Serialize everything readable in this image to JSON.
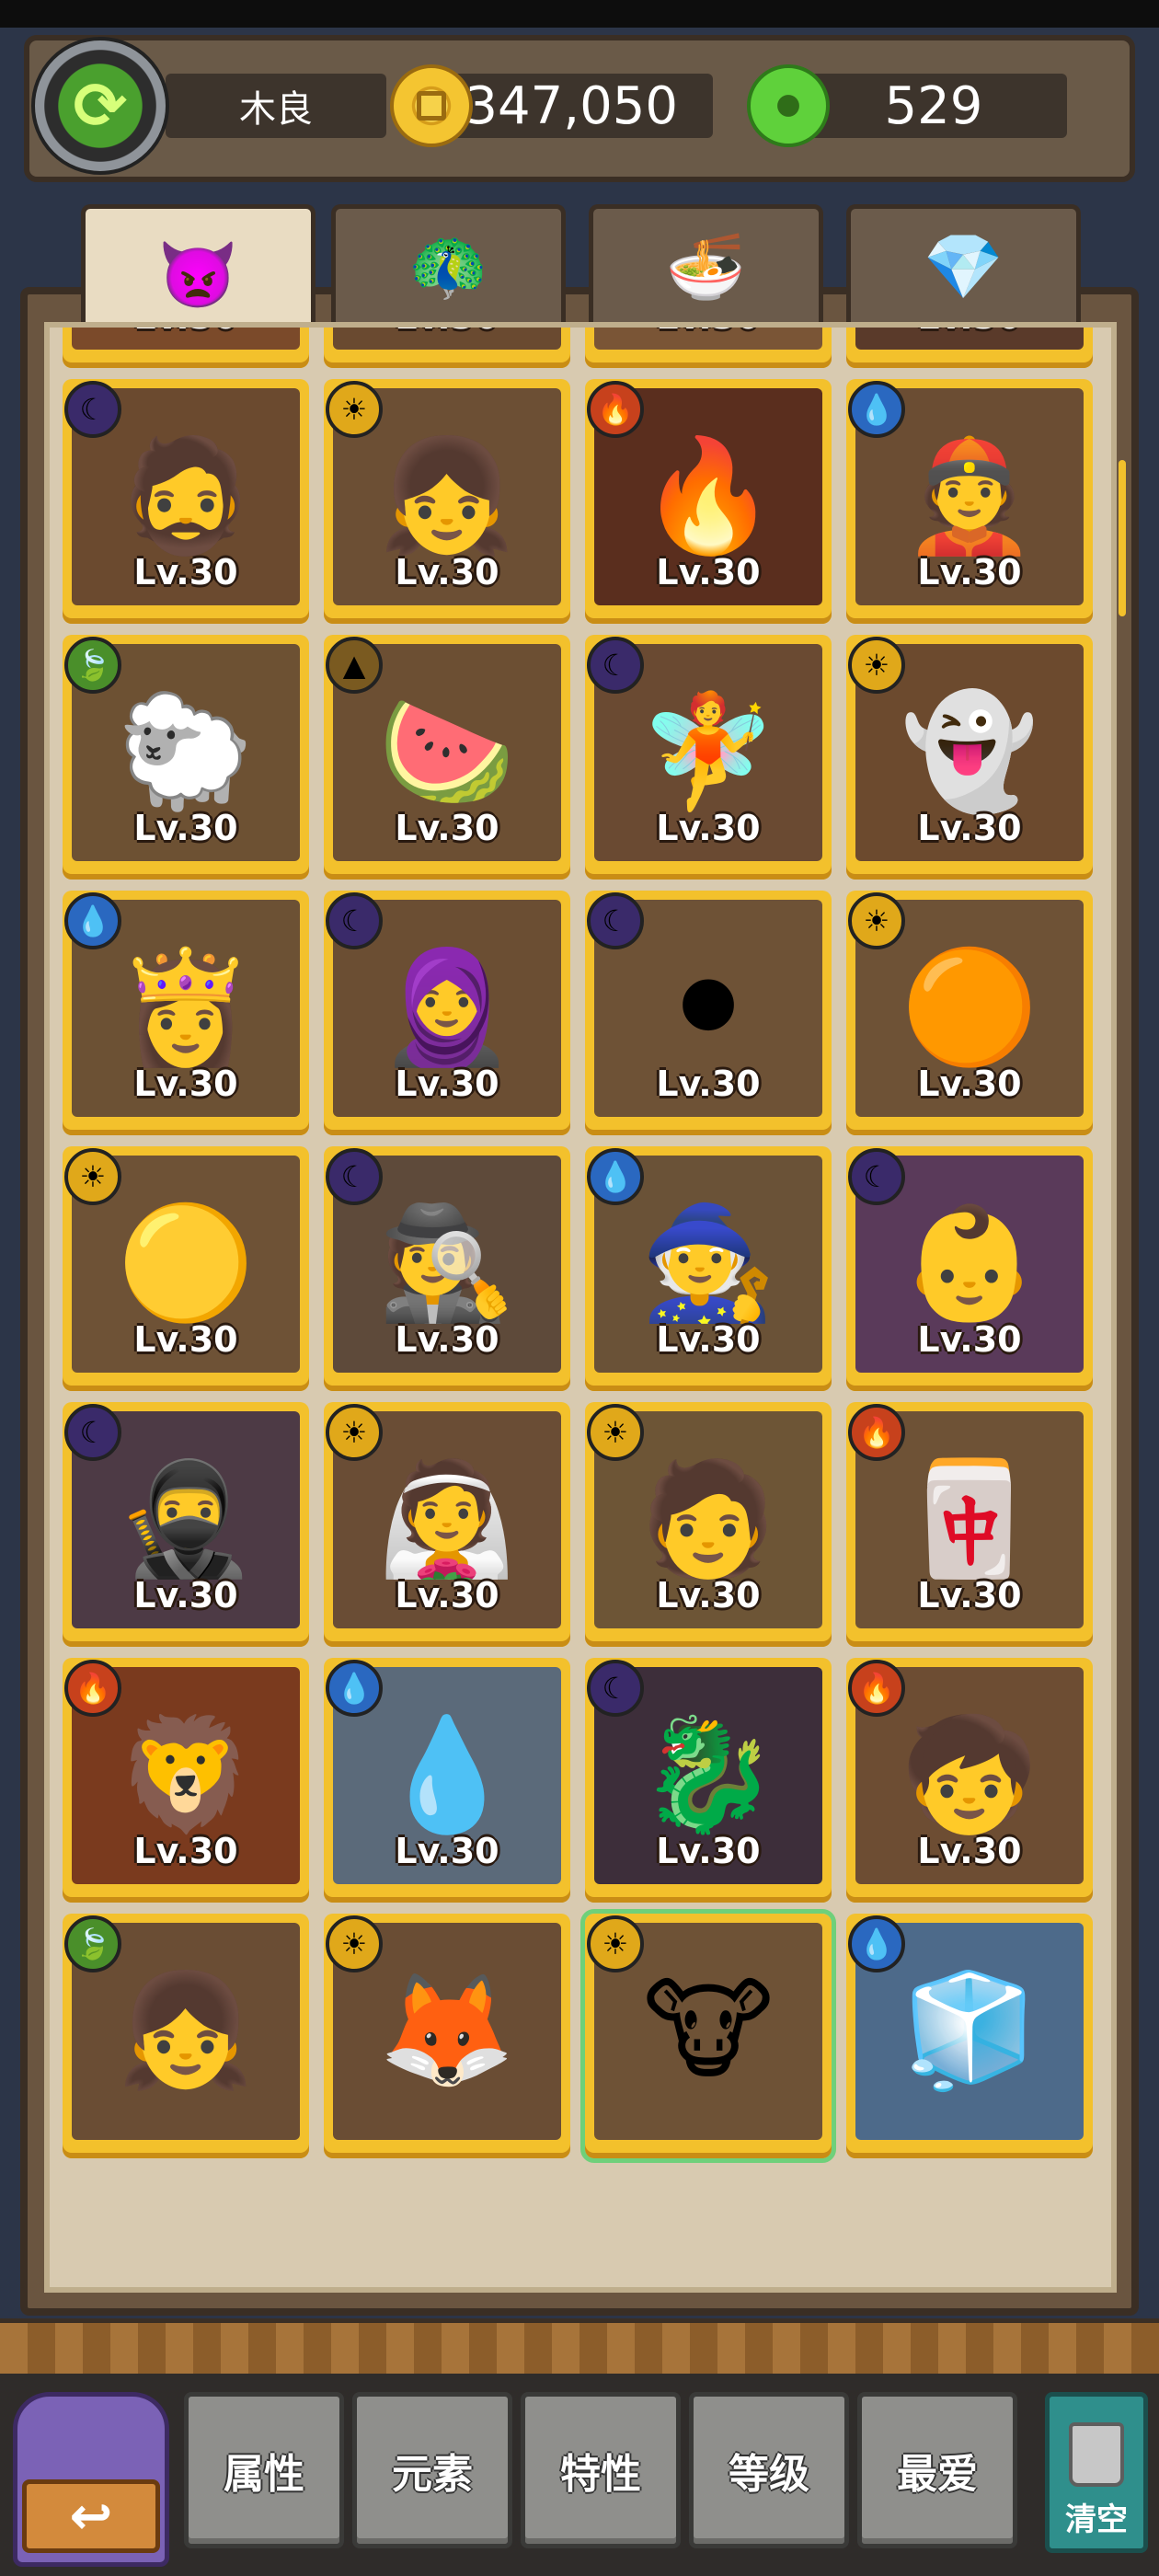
{
  "header": {
    "player_name": "木良",
    "coins": "347,050",
    "gems": "529"
  },
  "tabs": [
    {
      "label": "👿",
      "name": "monsters",
      "active": true
    },
    {
      "label": "🦚",
      "name": "relics",
      "active": false
    },
    {
      "label": "🍜",
      "name": "food",
      "active": false
    },
    {
      "label": "💎",
      "name": "crystal",
      "active": false
    }
  ],
  "cards": [
    {
      "portrait": "🧑‍🌾",
      "level": "Lv.30",
      "element": "fire",
      "bg": "#7b4a2a"
    },
    {
      "portrait": "🧝",
      "level": "Lv.30",
      "element": "water",
      "bg": "#6a4a30"
    },
    {
      "portrait": "🐯",
      "level": "Lv.30",
      "element": "leaf",
      "bg": "#7a5536"
    },
    {
      "portrait": "👩",
      "level": "Lv.30",
      "element": "earth",
      "bg": "#5a3a2a"
    },
    {
      "portrait": "🧔",
      "level": "Lv.30",
      "element": "moon",
      "bg": "#6b4a2f"
    },
    {
      "portrait": "👧",
      "level": "Lv.30",
      "element": "sun",
      "bg": "#6c4f34"
    },
    {
      "portrait": "🔥",
      "level": "Lv.30",
      "element": "fire",
      "bg": "#5a2e1e"
    },
    {
      "portrait": "👲",
      "level": "Lv.30",
      "element": "water",
      "bg": "#6b4d33"
    },
    {
      "portrait": "🐑",
      "level": "Lv.30",
      "element": "leaf",
      "bg": "#6d5133"
    },
    {
      "portrait": "🍉",
      "level": "Lv.30",
      "element": "earth",
      "bg": "#6c4f33"
    },
    {
      "portrait": "🧚",
      "level": "Lv.30",
      "element": "moon",
      "bg": "#6a4a32"
    },
    {
      "portrait": "👻",
      "level": "Lv.30",
      "element": "sun",
      "bg": "#6c4a2e"
    },
    {
      "portrait": "👸",
      "level": "Lv.30",
      "element": "water",
      "bg": "#6c5134"
    },
    {
      "portrait": "🧕",
      "level": "Lv.30",
      "element": "moon",
      "bg": "#6b4e33"
    },
    {
      "portrait": "⚫",
      "level": "Lv.30",
      "element": "moon",
      "bg": "#6e5236"
    },
    {
      "portrait": "🟠",
      "level": "Lv.30",
      "element": "sun",
      "bg": "#6e5236"
    },
    {
      "portrait": "🟡",
      "level": "Lv.30",
      "element": "sun",
      "bg": "#6e5236"
    },
    {
      "portrait": "🕵",
      "level": "Lv.30",
      "element": "moon",
      "bg": "#5e4a3a"
    },
    {
      "portrait": "🧙",
      "level": "Lv.30",
      "element": "water",
      "bg": "#6a5237"
    },
    {
      "portrait": "👶",
      "level": "Lv.30",
      "element": "moon",
      "bg": "#5a3a5a"
    },
    {
      "portrait": "🥷",
      "level": "Lv.30",
      "element": "moon",
      "bg": "#4d3a45"
    },
    {
      "portrait": "👰",
      "level": "Lv.30",
      "element": "sun",
      "bg": "#6a4d35"
    },
    {
      "portrait": "🧑",
      "level": "Lv.30",
      "element": "sun",
      "bg": "#6d5536"
    },
    {
      "portrait": "🀄",
      "level": "Lv.30",
      "element": "fire",
      "bg": "#6e5236"
    },
    {
      "portrait": "🦁",
      "level": "Lv.30",
      "element": "fire",
      "bg": "#7a3a1e"
    },
    {
      "portrait": "💧",
      "level": "Lv.30",
      "element": "water",
      "bg": "#5b6a7a"
    },
    {
      "portrait": "🐉",
      "level": "Lv.30",
      "element": "moon",
      "bg": "#3d2e3a"
    },
    {
      "portrait": "🧒",
      "level": "Lv.30",
      "element": "fire",
      "bg": "#6d4d33"
    },
    {
      "portrait": "👧",
      "level": "",
      "element": "leaf",
      "bg": "#6a4d34"
    },
    {
      "portrait": "🦊",
      "level": "",
      "element": "sun",
      "bg": "#6a4d34"
    },
    {
      "portrait": "🐮",
      "level": "",
      "element": "sun",
      "bg": "#6e5236",
      "selected": true
    },
    {
      "portrait": "🧊",
      "level": "",
      "element": "water",
      "bg": "#4d6a8a"
    }
  ],
  "elements": {
    "fire": {
      "glyph": "🔥",
      "color": "#c7411c"
    },
    "water": {
      "glyph": "💧",
      "color": "#2a68c0"
    },
    "leaf": {
      "glyph": "🍃",
      "color": "#4a8f2a"
    },
    "earth": {
      "glyph": "▲",
      "color": "#7a5a20"
    },
    "moon": {
      "glyph": "☾",
      "color": "#3a2a6a"
    },
    "sun": {
      "glyph": "☀",
      "color": "#e0a81a"
    }
  },
  "filters": [
    {
      "label": "属性",
      "name": "attribute"
    },
    {
      "label": "元素",
      "name": "element"
    },
    {
      "label": "特性",
      "name": "trait"
    },
    {
      "label": "等级",
      "name": "level"
    },
    {
      "label": "最爱",
      "name": "favorite"
    }
  ],
  "clear_label": "清空",
  "back_glyph": "↩"
}
